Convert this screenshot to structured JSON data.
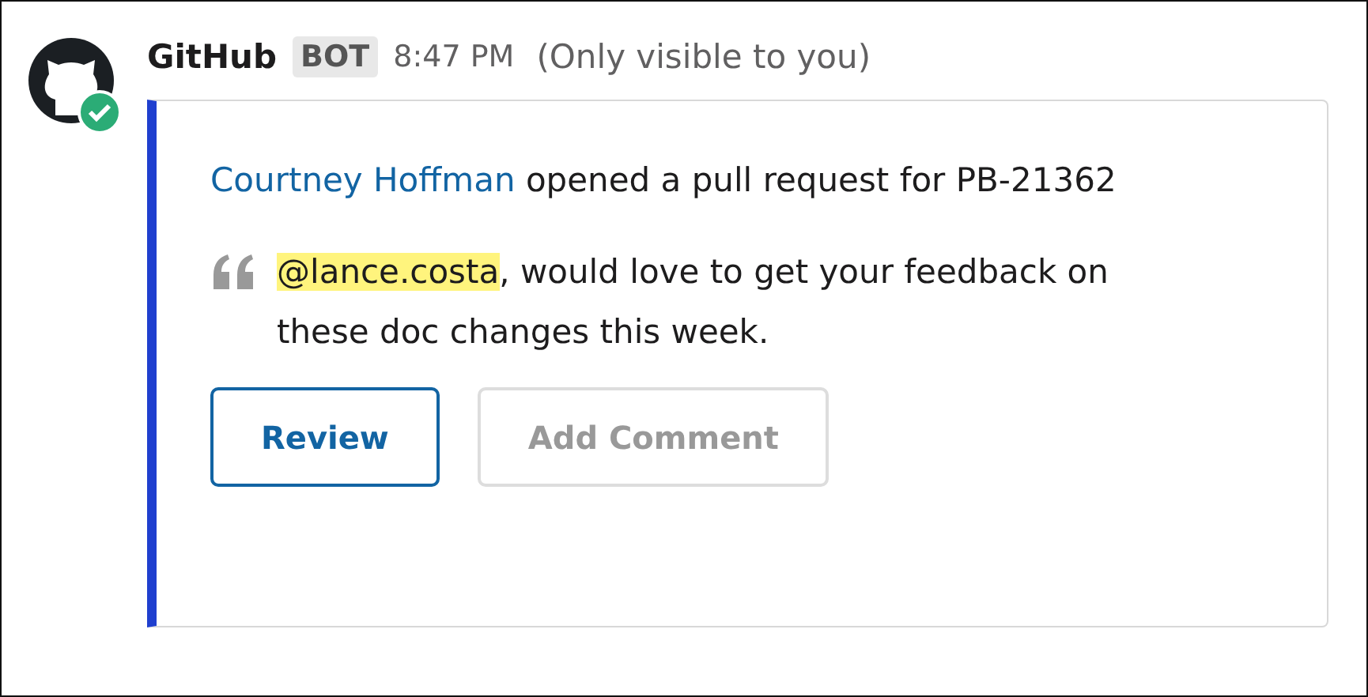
{
  "message": {
    "sender": "GitHub",
    "badge": "BOT",
    "time": "8:47 PM",
    "note": "(Only visible to you)",
    "verified": true
  },
  "card": {
    "author": "Courtney Hoffman",
    "text": "opened a pull request for PB-21362",
    "quote": {
      "mention": "@lance.costa",
      "text": ", would love to get your feedback on these doc changes this week."
    },
    "buttons": [
      {
        "label": "Review",
        "kind": "primary"
      },
      {
        "label": "Add Comment",
        "kind": "secondary"
      }
    ]
  }
}
